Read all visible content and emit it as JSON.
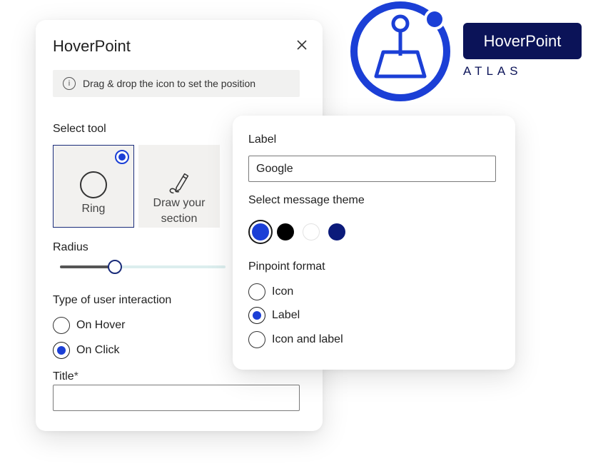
{
  "colors": {
    "accent": "#1b3fd6",
    "navy": "#0b1358",
    "border": "#1a2c7a"
  },
  "main_panel": {
    "title": "HoverPoint",
    "close_icon": "close-icon",
    "info_text": "Drag & drop the icon to set the position",
    "select_tool_label": "Select tool",
    "tools": [
      {
        "label": "Ring",
        "icon": "ring-icon",
        "selected": true
      },
      {
        "label_line1": "Draw your",
        "label_line2": "section",
        "icon": "pen-draw-icon",
        "selected": false
      }
    ],
    "radius_label": "Radius",
    "radius_value_fraction": 0.33,
    "interaction_label": "Type of user interaction",
    "interaction_options": [
      {
        "label": "On Hover",
        "checked": false
      },
      {
        "label": "On Click",
        "checked": true
      }
    ],
    "title_field_label": "Title",
    "title_required_mark": "*",
    "title_value": ""
  },
  "sub_panel": {
    "label_field_label": "Label",
    "label_value": "Google",
    "theme_label": "Select message theme",
    "themes": [
      {
        "color": "#1b3fd6",
        "selected": true
      },
      {
        "color": "#000000",
        "selected": false
      },
      {
        "color": "#ffffff",
        "selected": false
      },
      {
        "color": "#0b1a7a",
        "selected": false
      }
    ],
    "format_label": "Pinpoint format",
    "format_options": [
      {
        "label": "Icon",
        "checked": false
      },
      {
        "label": "Label",
        "checked": true
      },
      {
        "label": "Icon and label",
        "checked": false
      }
    ]
  },
  "logo": {
    "brand": "HoverPoint",
    "subbrand": "ATLAS",
    "icon": "joystick-icon"
  }
}
